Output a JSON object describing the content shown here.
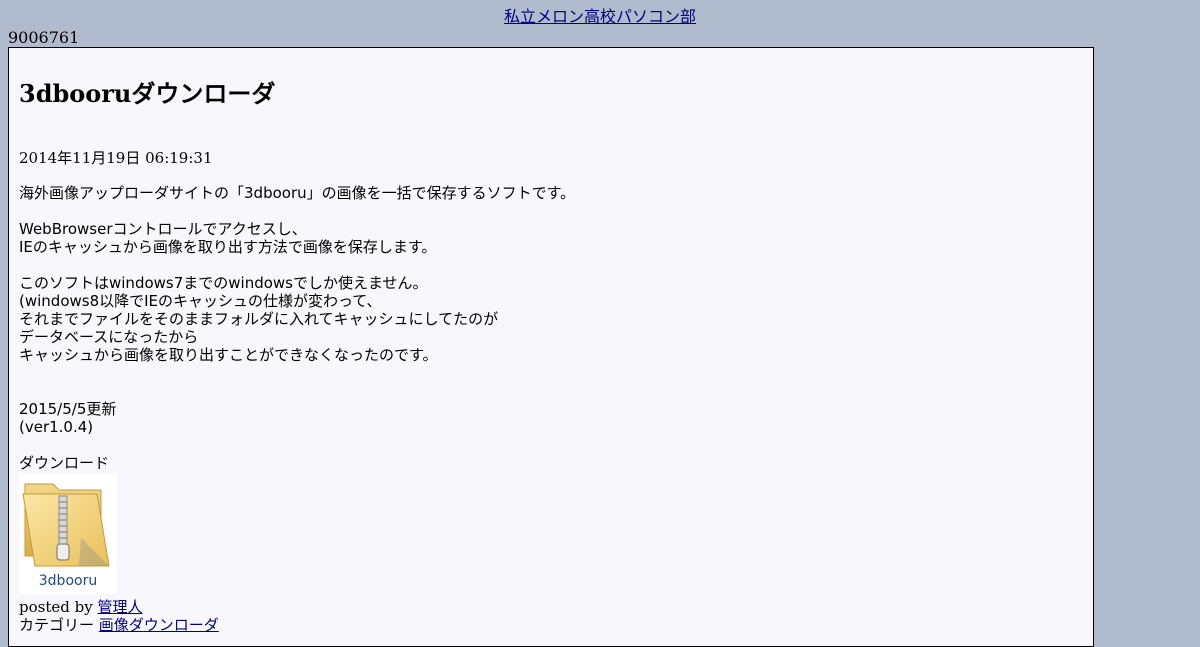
{
  "site": {
    "title": "私立メロン高校パソコン部"
  },
  "counter": "9006761",
  "post": {
    "title": "3dbooruダウンローダ",
    "date": "2014年11月19日 06:19:31",
    "lines": {
      "l1": "海外画像アップローダサイトの「3dbooru」の画像を一括で保存するソフトです。",
      "l2": "WebBrowserコントロールでアクセスし、",
      "l3": "IEのキャッシュから画像を取り出す方法で画像を保存します。",
      "l4": "このソフトはwindows7までのwindowsでしか使えません。",
      "l5": "(windows8以降でIEのキャッシュの仕様が変わって、",
      "l6": "それまでファイルをそのままフォルダに入れてキャッシュにしてたのが",
      "l7": "データベースになったから",
      "l8": "キャッシュから画像を取り出すことができなくなったのです。",
      "l9": "2015/5/5更新",
      "l10": "(ver1.0.4)",
      "l11": "ダウンロード"
    },
    "download": {
      "label": "3dbooru",
      "icon": "zip-folder-icon"
    },
    "posted_by_prefix": "posted by ",
    "author": "管理人",
    "category_prefix": "カテゴリー ",
    "category": "画像ダウンローダ"
  }
}
